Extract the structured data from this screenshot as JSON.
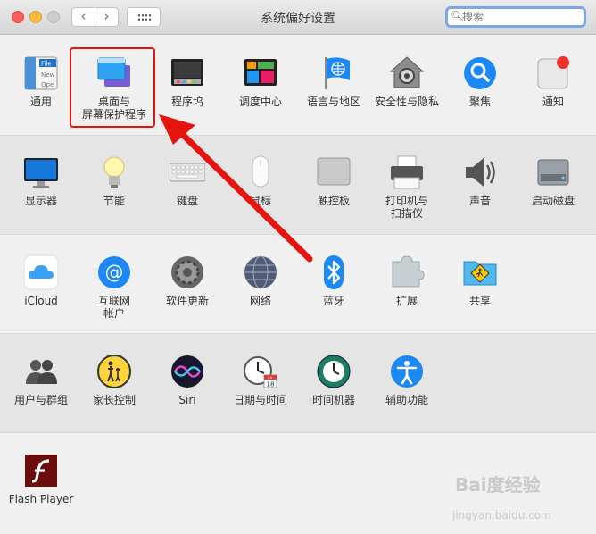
{
  "window": {
    "title": "系统偏好设置"
  },
  "search": {
    "placeholder": "搜索"
  },
  "rows": [
    [
      {
        "id": "general",
        "label": "通用",
        "icon": "general-icon"
      },
      {
        "id": "desktop",
        "label": "桌面与\n屏幕保护程序",
        "icon": "desktop-screensaver-icon"
      },
      {
        "id": "dock",
        "label": "程序坞",
        "icon": "dock-icon"
      },
      {
        "id": "mission",
        "label": "调度中心",
        "icon": "mission-control-icon"
      },
      {
        "id": "language",
        "label": "语言与地区",
        "icon": "language-region-icon"
      },
      {
        "id": "security",
        "label": "安全性与隐私",
        "icon": "security-privacy-icon"
      },
      {
        "id": "spotlight",
        "label": "聚焦",
        "icon": "spotlight-icon"
      },
      {
        "id": "notify",
        "label": "通知",
        "icon": "notifications-icon"
      }
    ],
    [
      {
        "id": "displays",
        "label": "显示器",
        "icon": "displays-icon"
      },
      {
        "id": "energy",
        "label": "节能",
        "icon": "energy-saver-icon"
      },
      {
        "id": "keyboard",
        "label": "键盘",
        "icon": "keyboard-icon"
      },
      {
        "id": "mouse",
        "label": "鼠标",
        "icon": "mouse-icon"
      },
      {
        "id": "trackpad",
        "label": "触控板",
        "icon": "trackpad-icon"
      },
      {
        "id": "printers",
        "label": "打印机与\n扫描仪",
        "icon": "printer-scanner-icon"
      },
      {
        "id": "sound",
        "label": "声音",
        "icon": "sound-icon"
      },
      {
        "id": "startup",
        "label": "启动磁盘",
        "icon": "startup-disk-icon"
      }
    ],
    [
      {
        "id": "icloud",
        "label": "iCloud",
        "icon": "icloud-icon"
      },
      {
        "id": "internet",
        "label": "互联网\n帐户",
        "icon": "internet-accounts-icon"
      },
      {
        "id": "update",
        "label": "软件更新",
        "icon": "software-update-icon"
      },
      {
        "id": "network",
        "label": "网络",
        "icon": "network-icon"
      },
      {
        "id": "bluetooth",
        "label": "蓝牙",
        "icon": "bluetooth-icon"
      },
      {
        "id": "extensions",
        "label": "扩展",
        "icon": "extensions-icon"
      },
      {
        "id": "sharing",
        "label": "共享",
        "icon": "sharing-icon"
      }
    ],
    [
      {
        "id": "users",
        "label": "用户与群组",
        "icon": "users-groups-icon"
      },
      {
        "id": "parental",
        "label": "家长控制",
        "icon": "parental-controls-icon"
      },
      {
        "id": "siri",
        "label": "Siri",
        "icon": "siri-icon"
      },
      {
        "id": "datetime",
        "label": "日期与时间",
        "icon": "date-time-icon"
      },
      {
        "id": "timemachine",
        "label": "时间机器",
        "icon": "time-machine-icon"
      },
      {
        "id": "access",
        "label": "辅助功能",
        "icon": "accessibility-icon"
      }
    ],
    [
      {
        "id": "flash",
        "label": "Flash Player",
        "icon": "flash-player-icon"
      }
    ]
  ],
  "icon_text": {
    "general_file": "File",
    "general_new": "New",
    "general_ope": "Ope",
    "calendar_day": "18",
    "calendar_month": "JUL"
  },
  "colors": {
    "highlight": "#e6140f",
    "arrow": "#e6140f",
    "accent": "#1b88f5"
  },
  "watermark": {
    "brand": "Bai度经验",
    "url": "jingyan.baidu.com"
  }
}
